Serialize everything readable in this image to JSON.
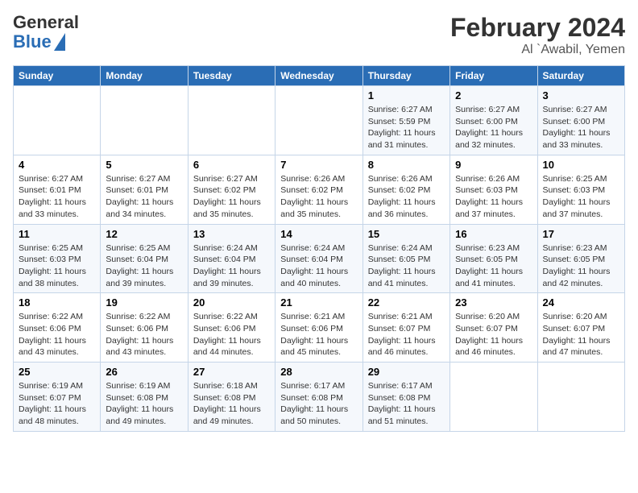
{
  "logo": {
    "general": "General",
    "blue": "Blue"
  },
  "title": "February 2024",
  "subtitle": "Al `Awabil, Yemen",
  "days_header": [
    "Sunday",
    "Monday",
    "Tuesday",
    "Wednesday",
    "Thursday",
    "Friday",
    "Saturday"
  ],
  "weeks": [
    [
      {
        "day": "",
        "info": ""
      },
      {
        "day": "",
        "info": ""
      },
      {
        "day": "",
        "info": ""
      },
      {
        "day": "",
        "info": ""
      },
      {
        "day": "1",
        "info": "Sunrise: 6:27 AM\nSunset: 5:59 PM\nDaylight: 11 hours\nand 31 minutes."
      },
      {
        "day": "2",
        "info": "Sunrise: 6:27 AM\nSunset: 6:00 PM\nDaylight: 11 hours\nand 32 minutes."
      },
      {
        "day": "3",
        "info": "Sunrise: 6:27 AM\nSunset: 6:00 PM\nDaylight: 11 hours\nand 33 minutes."
      }
    ],
    [
      {
        "day": "4",
        "info": "Sunrise: 6:27 AM\nSunset: 6:01 PM\nDaylight: 11 hours\nand 33 minutes."
      },
      {
        "day": "5",
        "info": "Sunrise: 6:27 AM\nSunset: 6:01 PM\nDaylight: 11 hours\nand 34 minutes."
      },
      {
        "day": "6",
        "info": "Sunrise: 6:27 AM\nSunset: 6:02 PM\nDaylight: 11 hours\nand 35 minutes."
      },
      {
        "day": "7",
        "info": "Sunrise: 6:26 AM\nSunset: 6:02 PM\nDaylight: 11 hours\nand 35 minutes."
      },
      {
        "day": "8",
        "info": "Sunrise: 6:26 AM\nSunset: 6:02 PM\nDaylight: 11 hours\nand 36 minutes."
      },
      {
        "day": "9",
        "info": "Sunrise: 6:26 AM\nSunset: 6:03 PM\nDaylight: 11 hours\nand 37 minutes."
      },
      {
        "day": "10",
        "info": "Sunrise: 6:25 AM\nSunset: 6:03 PM\nDaylight: 11 hours\nand 37 minutes."
      }
    ],
    [
      {
        "day": "11",
        "info": "Sunrise: 6:25 AM\nSunset: 6:03 PM\nDaylight: 11 hours\nand 38 minutes."
      },
      {
        "day": "12",
        "info": "Sunrise: 6:25 AM\nSunset: 6:04 PM\nDaylight: 11 hours\nand 39 minutes."
      },
      {
        "day": "13",
        "info": "Sunrise: 6:24 AM\nSunset: 6:04 PM\nDaylight: 11 hours\nand 39 minutes."
      },
      {
        "day": "14",
        "info": "Sunrise: 6:24 AM\nSunset: 6:04 PM\nDaylight: 11 hours\nand 40 minutes."
      },
      {
        "day": "15",
        "info": "Sunrise: 6:24 AM\nSunset: 6:05 PM\nDaylight: 11 hours\nand 41 minutes."
      },
      {
        "day": "16",
        "info": "Sunrise: 6:23 AM\nSunset: 6:05 PM\nDaylight: 11 hours\nand 41 minutes."
      },
      {
        "day": "17",
        "info": "Sunrise: 6:23 AM\nSunset: 6:05 PM\nDaylight: 11 hours\nand 42 minutes."
      }
    ],
    [
      {
        "day": "18",
        "info": "Sunrise: 6:22 AM\nSunset: 6:06 PM\nDaylight: 11 hours\nand 43 minutes."
      },
      {
        "day": "19",
        "info": "Sunrise: 6:22 AM\nSunset: 6:06 PM\nDaylight: 11 hours\nand 43 minutes."
      },
      {
        "day": "20",
        "info": "Sunrise: 6:22 AM\nSunset: 6:06 PM\nDaylight: 11 hours\nand 44 minutes."
      },
      {
        "day": "21",
        "info": "Sunrise: 6:21 AM\nSunset: 6:06 PM\nDaylight: 11 hours\nand 45 minutes."
      },
      {
        "day": "22",
        "info": "Sunrise: 6:21 AM\nSunset: 6:07 PM\nDaylight: 11 hours\nand 46 minutes."
      },
      {
        "day": "23",
        "info": "Sunrise: 6:20 AM\nSunset: 6:07 PM\nDaylight: 11 hours\nand 46 minutes."
      },
      {
        "day": "24",
        "info": "Sunrise: 6:20 AM\nSunset: 6:07 PM\nDaylight: 11 hours\nand 47 minutes."
      }
    ],
    [
      {
        "day": "25",
        "info": "Sunrise: 6:19 AM\nSunset: 6:07 PM\nDaylight: 11 hours\nand 48 minutes."
      },
      {
        "day": "26",
        "info": "Sunrise: 6:19 AM\nSunset: 6:08 PM\nDaylight: 11 hours\nand 49 minutes."
      },
      {
        "day": "27",
        "info": "Sunrise: 6:18 AM\nSunset: 6:08 PM\nDaylight: 11 hours\nand 49 minutes."
      },
      {
        "day": "28",
        "info": "Sunrise: 6:17 AM\nSunset: 6:08 PM\nDaylight: 11 hours\nand 50 minutes."
      },
      {
        "day": "29",
        "info": "Sunrise: 6:17 AM\nSunset: 6:08 PM\nDaylight: 11 hours\nand 51 minutes."
      },
      {
        "day": "",
        "info": ""
      },
      {
        "day": "",
        "info": ""
      }
    ]
  ]
}
